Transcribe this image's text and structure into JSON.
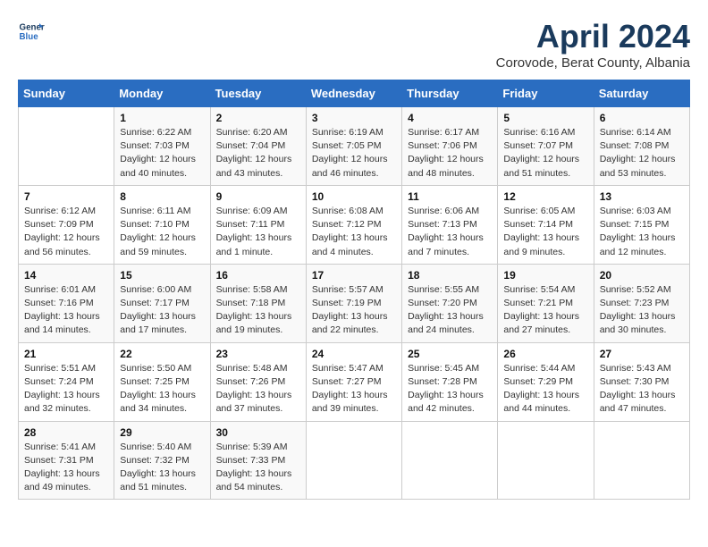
{
  "header": {
    "logo_line1": "General",
    "logo_line2": "Blue",
    "title": "April 2024",
    "subtitle": "Corovode, Berat County, Albania"
  },
  "weekdays": [
    "Sunday",
    "Monday",
    "Tuesday",
    "Wednesday",
    "Thursday",
    "Friday",
    "Saturday"
  ],
  "weeks": [
    [
      {
        "day": "",
        "detail": ""
      },
      {
        "day": "1",
        "detail": "Sunrise: 6:22 AM\nSunset: 7:03 PM\nDaylight: 12 hours\nand 40 minutes."
      },
      {
        "day": "2",
        "detail": "Sunrise: 6:20 AM\nSunset: 7:04 PM\nDaylight: 12 hours\nand 43 minutes."
      },
      {
        "day": "3",
        "detail": "Sunrise: 6:19 AM\nSunset: 7:05 PM\nDaylight: 12 hours\nand 46 minutes."
      },
      {
        "day": "4",
        "detail": "Sunrise: 6:17 AM\nSunset: 7:06 PM\nDaylight: 12 hours\nand 48 minutes."
      },
      {
        "day": "5",
        "detail": "Sunrise: 6:16 AM\nSunset: 7:07 PM\nDaylight: 12 hours\nand 51 minutes."
      },
      {
        "day": "6",
        "detail": "Sunrise: 6:14 AM\nSunset: 7:08 PM\nDaylight: 12 hours\nand 53 minutes."
      }
    ],
    [
      {
        "day": "7",
        "detail": "Sunrise: 6:12 AM\nSunset: 7:09 PM\nDaylight: 12 hours\nand 56 minutes."
      },
      {
        "day": "8",
        "detail": "Sunrise: 6:11 AM\nSunset: 7:10 PM\nDaylight: 12 hours\nand 59 minutes."
      },
      {
        "day": "9",
        "detail": "Sunrise: 6:09 AM\nSunset: 7:11 PM\nDaylight: 13 hours\nand 1 minute."
      },
      {
        "day": "10",
        "detail": "Sunrise: 6:08 AM\nSunset: 7:12 PM\nDaylight: 13 hours\nand 4 minutes."
      },
      {
        "day": "11",
        "detail": "Sunrise: 6:06 AM\nSunset: 7:13 PM\nDaylight: 13 hours\nand 7 minutes."
      },
      {
        "day": "12",
        "detail": "Sunrise: 6:05 AM\nSunset: 7:14 PM\nDaylight: 13 hours\nand 9 minutes."
      },
      {
        "day": "13",
        "detail": "Sunrise: 6:03 AM\nSunset: 7:15 PM\nDaylight: 13 hours\nand 12 minutes."
      }
    ],
    [
      {
        "day": "14",
        "detail": "Sunrise: 6:01 AM\nSunset: 7:16 PM\nDaylight: 13 hours\nand 14 minutes."
      },
      {
        "day": "15",
        "detail": "Sunrise: 6:00 AM\nSunset: 7:17 PM\nDaylight: 13 hours\nand 17 minutes."
      },
      {
        "day": "16",
        "detail": "Sunrise: 5:58 AM\nSunset: 7:18 PM\nDaylight: 13 hours\nand 19 minutes."
      },
      {
        "day": "17",
        "detail": "Sunrise: 5:57 AM\nSunset: 7:19 PM\nDaylight: 13 hours\nand 22 minutes."
      },
      {
        "day": "18",
        "detail": "Sunrise: 5:55 AM\nSunset: 7:20 PM\nDaylight: 13 hours\nand 24 minutes."
      },
      {
        "day": "19",
        "detail": "Sunrise: 5:54 AM\nSunset: 7:21 PM\nDaylight: 13 hours\nand 27 minutes."
      },
      {
        "day": "20",
        "detail": "Sunrise: 5:52 AM\nSunset: 7:23 PM\nDaylight: 13 hours\nand 30 minutes."
      }
    ],
    [
      {
        "day": "21",
        "detail": "Sunrise: 5:51 AM\nSunset: 7:24 PM\nDaylight: 13 hours\nand 32 minutes."
      },
      {
        "day": "22",
        "detail": "Sunrise: 5:50 AM\nSunset: 7:25 PM\nDaylight: 13 hours\nand 34 minutes."
      },
      {
        "day": "23",
        "detail": "Sunrise: 5:48 AM\nSunset: 7:26 PM\nDaylight: 13 hours\nand 37 minutes."
      },
      {
        "day": "24",
        "detail": "Sunrise: 5:47 AM\nSunset: 7:27 PM\nDaylight: 13 hours\nand 39 minutes."
      },
      {
        "day": "25",
        "detail": "Sunrise: 5:45 AM\nSunset: 7:28 PM\nDaylight: 13 hours\nand 42 minutes."
      },
      {
        "day": "26",
        "detail": "Sunrise: 5:44 AM\nSunset: 7:29 PM\nDaylight: 13 hours\nand 44 minutes."
      },
      {
        "day": "27",
        "detail": "Sunrise: 5:43 AM\nSunset: 7:30 PM\nDaylight: 13 hours\nand 47 minutes."
      }
    ],
    [
      {
        "day": "28",
        "detail": "Sunrise: 5:41 AM\nSunset: 7:31 PM\nDaylight: 13 hours\nand 49 minutes."
      },
      {
        "day": "29",
        "detail": "Sunrise: 5:40 AM\nSunset: 7:32 PM\nDaylight: 13 hours\nand 51 minutes."
      },
      {
        "day": "30",
        "detail": "Sunrise: 5:39 AM\nSunset: 7:33 PM\nDaylight: 13 hours\nand 54 minutes."
      },
      {
        "day": "",
        "detail": ""
      },
      {
        "day": "",
        "detail": ""
      },
      {
        "day": "",
        "detail": ""
      },
      {
        "day": "",
        "detail": ""
      }
    ]
  ]
}
